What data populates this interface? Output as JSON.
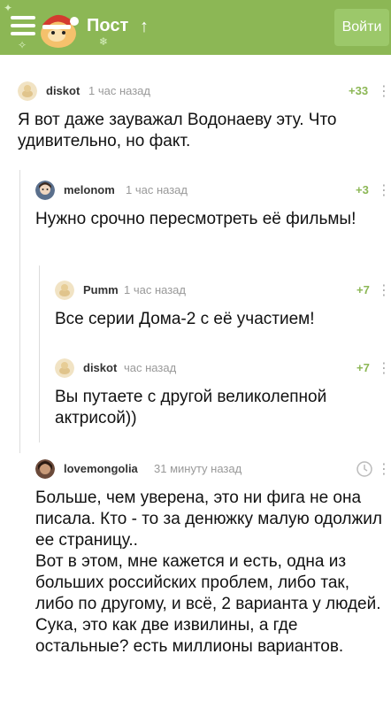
{
  "header": {
    "title": "Пост",
    "up_arrow": "↑",
    "login_label": "Войти",
    "accent_color": "#8cb755"
  },
  "comments": [
    {
      "user": "diskot",
      "time": "1 час назад",
      "rating": "+33",
      "text": "Я вот даже зауважал Водонаеву эту. Что удивительно, но факт.",
      "avatar_icon": "default-avatar-icon"
    },
    {
      "user": "melonom",
      "time": "1 час назад",
      "rating": "+3",
      "text": "Нужно срочно пересмотреть её фильмы!",
      "avatar_icon": "user-photo-avatar"
    },
    {
      "user": "Pumm",
      "time": "1 час назад",
      "rating": "+7",
      "text": "Все серии Дома-2 с её участием!",
      "avatar_icon": "default-avatar-icon"
    },
    {
      "user": "diskot",
      "time": "час назад",
      "rating": "+7",
      "text": "Вы путаете с другой великолепной актрисой))",
      "avatar_icon": "default-avatar-icon"
    },
    {
      "user": "lovemongolia",
      "time": "31 минуту назад",
      "rating": "",
      "text": "Больше, чем уверена, это ни фига не она писала. Кто - то за денюжку малую одолжил ее страницу..\nВот в этом, мне кажется и есть, одна из больших российских проблем, либо так, либо по другому, и всё, 2 варианта у людей. Сука, это как две извилины, а где остальные? есть миллионы вариантов.",
      "avatar_icon": "user-photo-avatar"
    }
  ],
  "icons": {
    "menu": "menu-icon",
    "more": "more-vertical-icon",
    "pending": "clock-icon"
  }
}
